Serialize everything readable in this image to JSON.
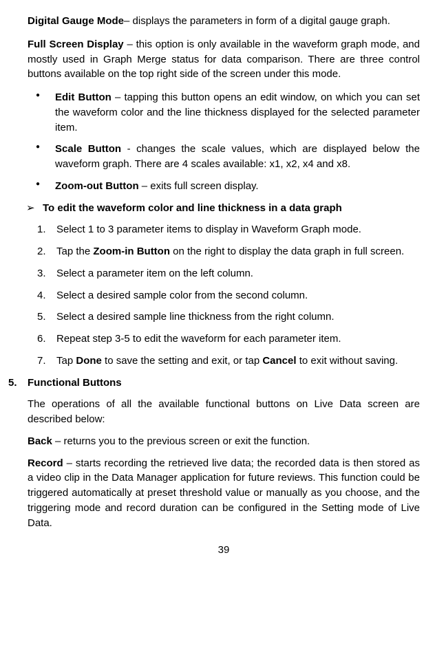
{
  "p1_strong": "Digital Gauge Mode",
  "p1_rest": "– displays the parameters in form of a digital gauge graph.",
  "p2_strong": "Full Screen Display",
  "p2_rest": " – this option is only available in the waveform graph mode, and mostly used in Graph Merge status for data comparison. There are three control buttons available on the top right side of the screen under this mode.",
  "bullets": {
    "b1_strong": "Edit Button",
    "b1_rest": " – tapping this button opens an edit window, on which you can set the waveform color and the line thickness displayed for the selected parameter item.",
    "b2_strong": "Scale Button",
    "b2_rest": " - changes the scale values, which are displayed below the waveform graph. There are 4 scales available: x1, x2, x4 and x8.",
    "b3_strong": "Zoom-out Button",
    "b3_rest": " – exits full screen display."
  },
  "pointer": "To edit the waveform color and line thickness in a data graph",
  "steps": {
    "s1": "Select 1 to 3 parameter items to display in Waveform Graph mode.",
    "s2a": "Tap the ",
    "s2b": "Zoom-in Button",
    "s2c": " on the right to display the data graph in full screen.",
    "s3": "Select a parameter item on the left column.",
    "s4": "Select a desired sample color from the second column.",
    "s5": "Select a desired sample line thickness from the right column.",
    "s6": "Repeat step 3-5 to edit the waveform for each parameter item.",
    "s7a": "Tap ",
    "s7b": "Done",
    "s7c": " to save the setting and exit, or tap ",
    "s7d": "Cancel",
    "s7e": " to exit without saving."
  },
  "section_num": "5.",
  "section_title": "Functional Buttons",
  "fb_intro": "The operations of all the available functional buttons on Live Data screen are described below:",
  "back_strong": "Back",
  "back_rest": " – returns you to the previous screen or exit the function.",
  "record_strong": "Record",
  "record_rest": " – starts recording the retrieved live data; the recorded data is then stored as a video clip in the Data Manager application for future reviews. This function could be triggered automatically at preset threshold value or manually as you choose, and the triggering mode and record duration can be configured in the Setting mode of Live Data.",
  "page_num": "39"
}
